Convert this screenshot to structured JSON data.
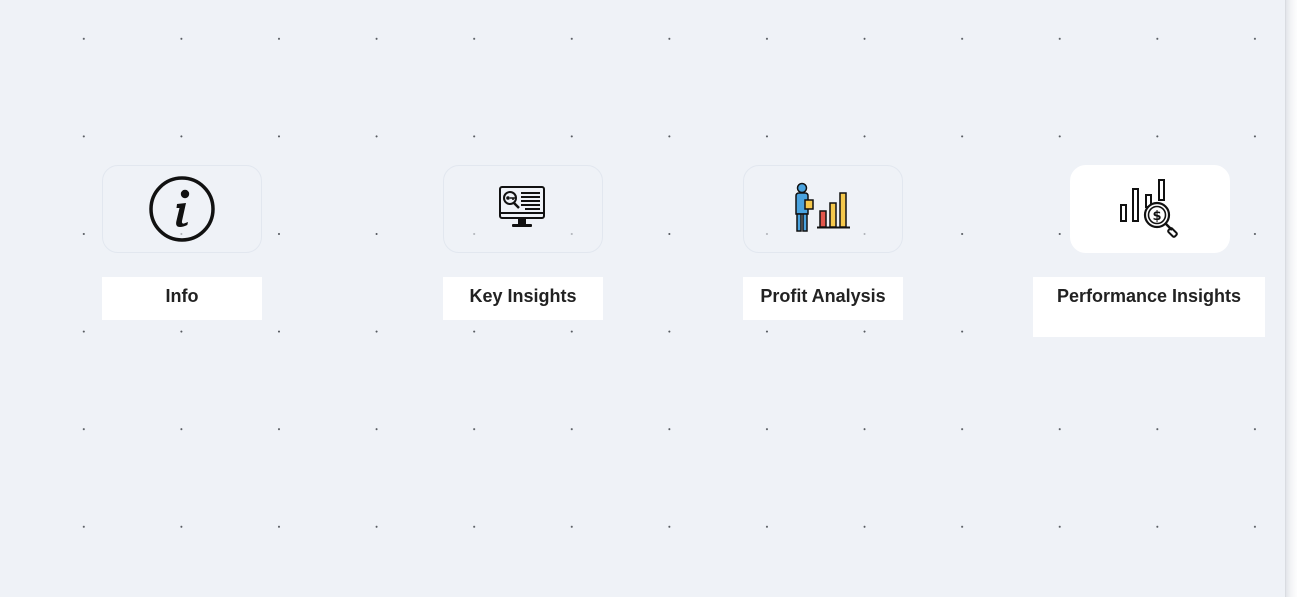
{
  "cards": [
    {
      "label": "Info",
      "icon": "info-icon"
    },
    {
      "label": "Key Insights",
      "icon": "monitor-key-insight-icon"
    },
    {
      "label": "Profit Analysis",
      "icon": "person-bar-chart-icon"
    },
    {
      "label": "Performance Insights",
      "icon": "chart-dollar-search-icon"
    }
  ],
  "colors": {
    "canvas_background": "#eff2f7",
    "grid_dot": "#55595f",
    "card_background": "#ffffff",
    "text": "#222222",
    "person_blue": "#4aa3df",
    "bar_red": "#e2574c",
    "bar_yellow": "#f5c84c"
  }
}
